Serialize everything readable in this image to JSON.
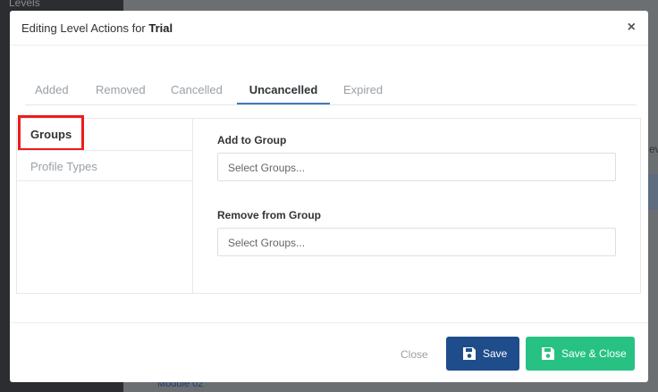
{
  "background": {
    "sidebar_label": "Levels",
    "module_link": "Module 02",
    "right_clip_text": "ev"
  },
  "modal": {
    "title_prefix": "Editing Level Actions for ",
    "title_level": "Trial",
    "close_symbol": "×"
  },
  "tabs": [
    {
      "label": "Added",
      "active": false
    },
    {
      "label": "Removed",
      "active": false
    },
    {
      "label": "Cancelled",
      "active": false
    },
    {
      "label": "Uncancelled",
      "active": true
    },
    {
      "label": "Expired",
      "active": false
    }
  ],
  "left_nav": [
    {
      "label": "Groups",
      "active": true,
      "highlighted": true
    },
    {
      "label": "Profile Types",
      "active": false
    }
  ],
  "fields": {
    "add_to_group": {
      "label": "Add to Group",
      "placeholder": "Select Groups..."
    },
    "remove_from_group": {
      "label": "Remove from Group",
      "placeholder": "Select Groups..."
    }
  },
  "footer": {
    "close_label": "Close",
    "save_label": "Save",
    "save_close_label": "Save & Close"
  },
  "colors": {
    "save_button": "#1f4d8c",
    "save_close_button": "#27c283",
    "active_tab_underline": "#3f78b5",
    "highlight_box": "#ee1c1c"
  },
  "icons": {
    "save": "floppy-disk-icon",
    "close": "close-icon"
  }
}
